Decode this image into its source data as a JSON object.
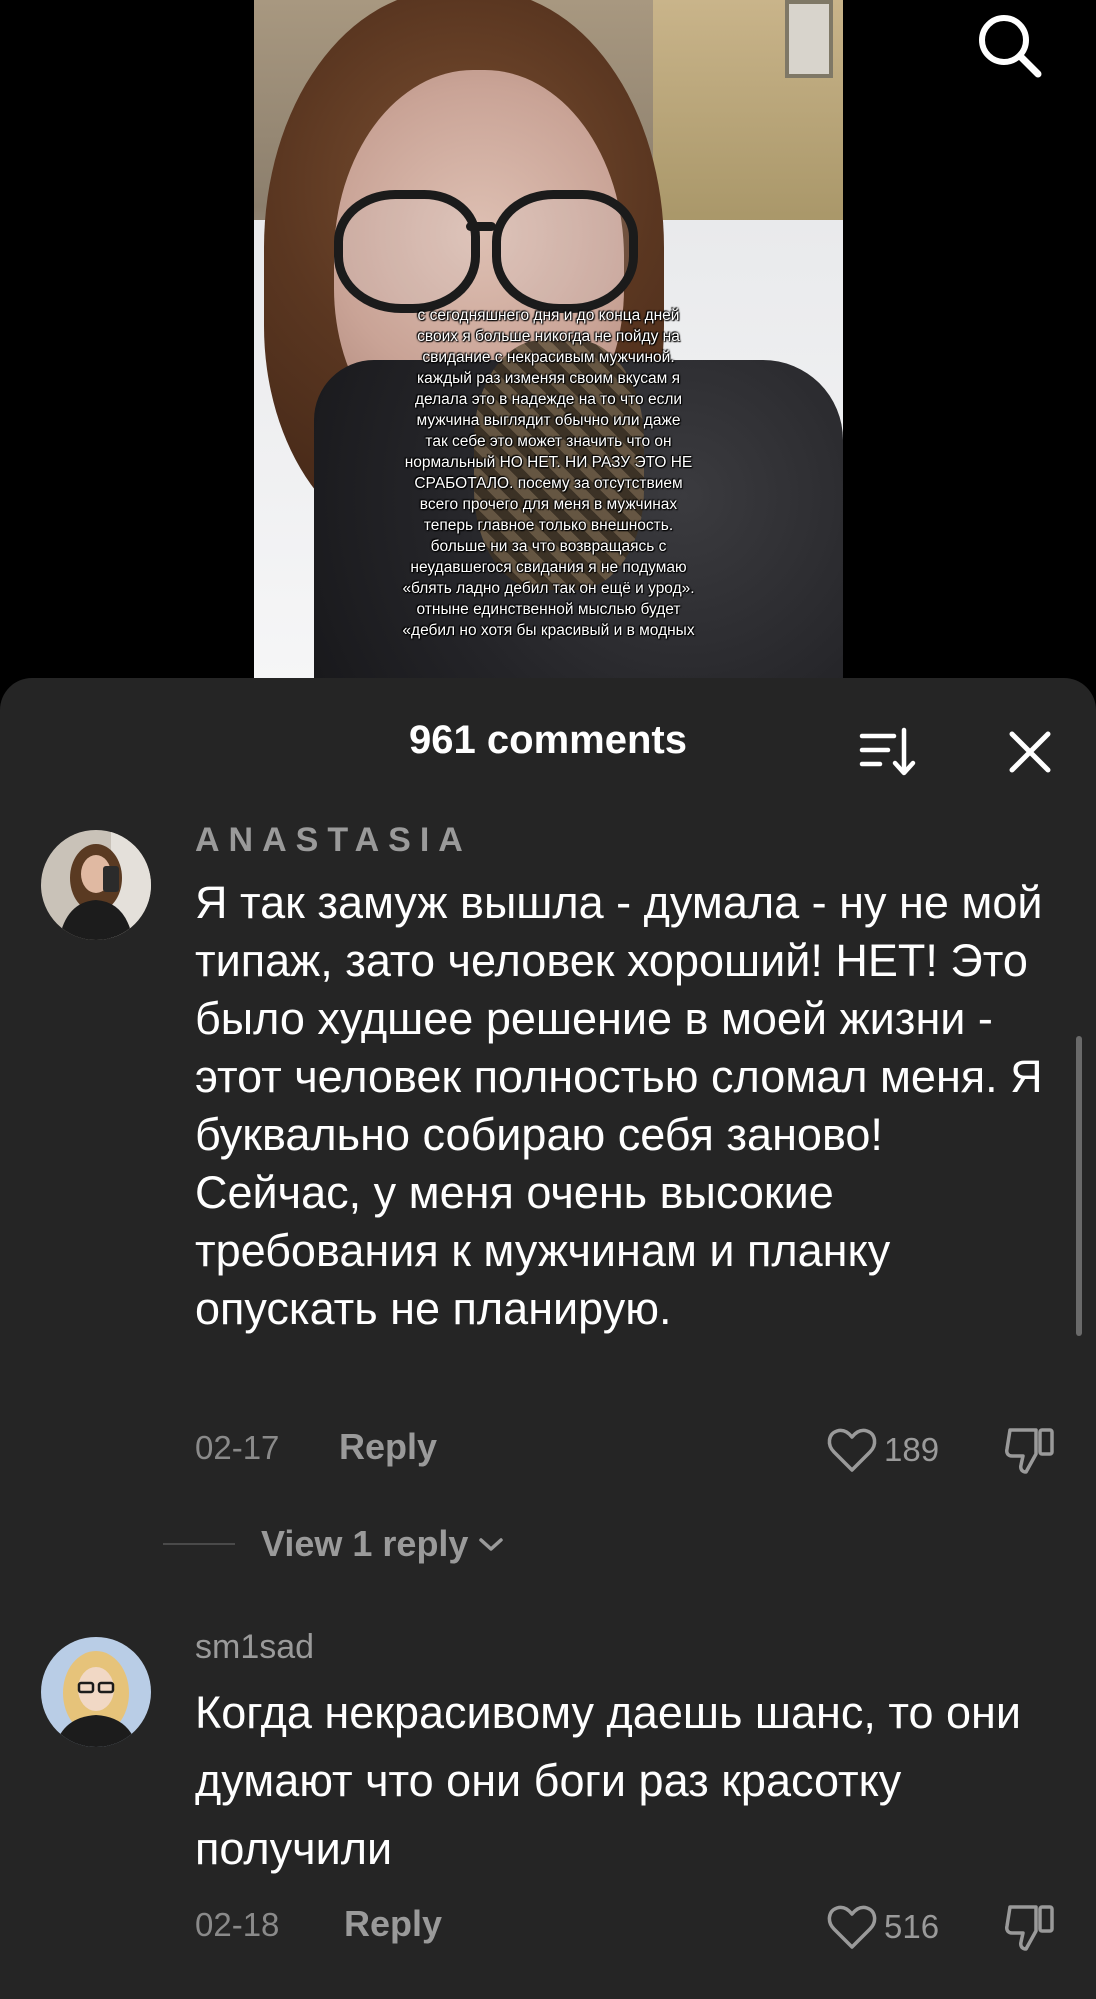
{
  "video": {
    "overlay_text": "с сегодняшнего дня и до конца дней\nсвоих я больше никогда не пойду на\nсвидание с некрасивым мужчиной.\nкаждый раз изменяя своим вкусам я\nделала это в надежде на то что если\nмужчина выглядит обычно или даже\nтак себе это может значить что он\nнормальный НО НЕТ. НИ РАЗУ ЭТО НЕ\nСРАБОТАЛО. посему за отсутствием\nвсего прочего для меня в мужчинах\nтеперь главное только внешность.\nбольше ни за что возвращаясь с\nнеудавшегося свидания я не подумаю\n«блять ладно дебил так он ещё и урод».\nотныне единственной мыслью будет\n«дебил но хотя бы красивый и в модных",
    "search_icon": "search-icon"
  },
  "comments_panel": {
    "count_label": "961 comments",
    "sort_icon": "sort-icon",
    "close_icon": "close-icon",
    "comments": [
      {
        "username": "ANASTASIA",
        "text": "Я так замуж вышла - думала - ну не мой типаж, зато человек хороший! НЕТ! Это было худшее решение в моей жизни - этот человек полностью сломал меня. Я буквально собираю себя заново! Сейчас, у меня очень высокие требования к мужчинам и планку опускать не планирую.",
        "date": "02-17",
        "reply_label": "Reply",
        "likes": "189",
        "view_replies_label": "View 1 reply"
      },
      {
        "username": "sm1sad",
        "text": "Когда некрасивому даешь шанс, то они думают что они боги раз красотку получили",
        "date": "02-18",
        "reply_label": "Reply",
        "likes": "516"
      }
    ]
  },
  "colors": {
    "sheet_background": "#252525",
    "muted_text": "#9a9a9a",
    "primary_text": "#ffffff"
  }
}
